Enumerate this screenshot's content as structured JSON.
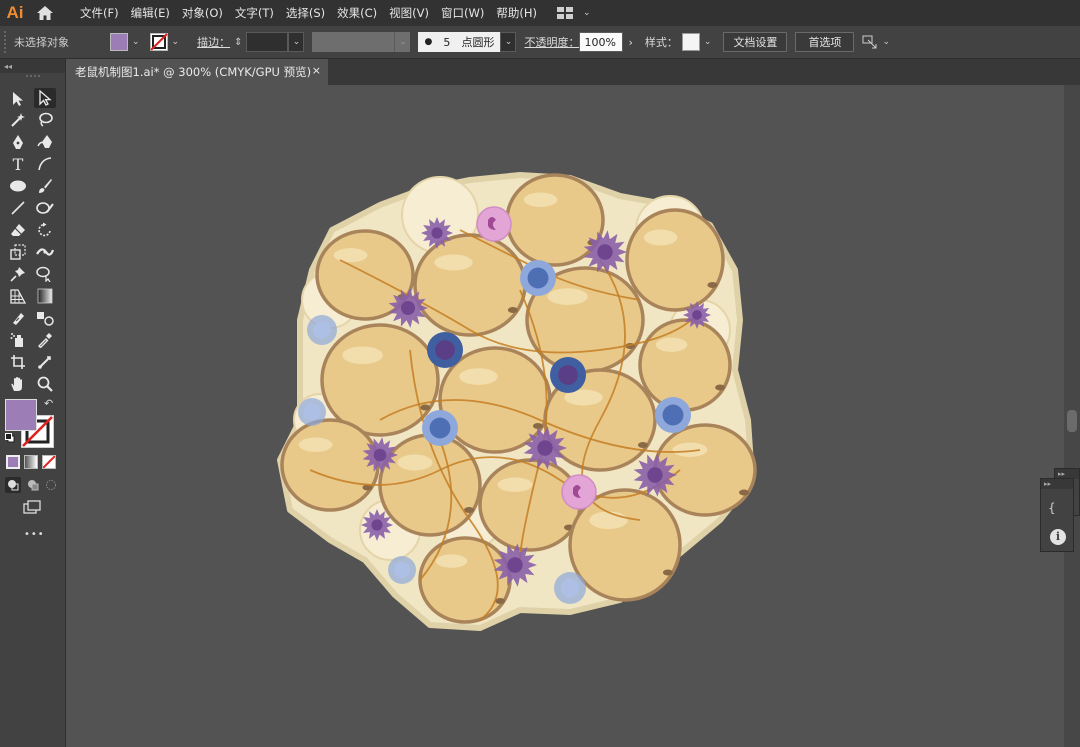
{
  "app": {
    "logo": "Ai"
  },
  "menubar": {
    "items": [
      "文件(F)",
      "编辑(E)",
      "对象(O)",
      "文字(T)",
      "选择(S)",
      "效果(C)",
      "视图(V)",
      "窗口(W)",
      "帮助(H)"
    ]
  },
  "controlbar": {
    "selection_label": "未选择对象",
    "fill_color": "#9c7db5",
    "stroke_label": "描边：",
    "brush_size": "5",
    "brush_shape": "点圆形",
    "opacity_label": "不透明度：",
    "opacity_value": "100%",
    "style_label": "样式：",
    "doc_setup_button": "文档设置",
    "preferences_button": "首选项"
  },
  "tab": {
    "title": "老鼠机制图1.ai* @ 300% (CMYK/GPU 预览)",
    "close": "×"
  },
  "toolbar": {
    "fill_color": "#9c7db5",
    "more": "•••"
  },
  "colors": {
    "adipocyte": "#e8c98a",
    "adipocyte_edge": "#a9845a",
    "background_cell": "#f1e6c4",
    "macrophage": "#8a5fa8",
    "lymphocyte_dark": "#3f5fa0",
    "lymphocyte_light": "#8fa8dc",
    "neutrophil": "#e3a4d6",
    "vessel": "#c47e22"
  }
}
